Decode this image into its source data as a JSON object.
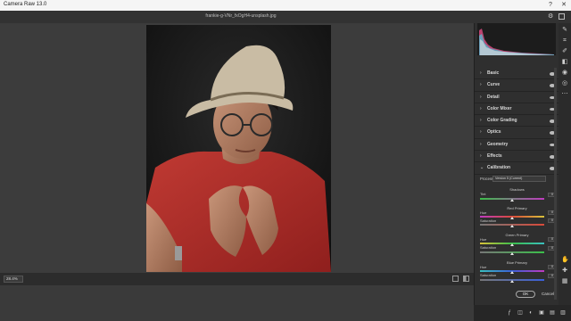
{
  "window": {
    "title": "Camera Raw 13.0",
    "help_label": "?",
    "close_label": "✕"
  },
  "file": {
    "name": "frankie-g-VNr_fxOgH4-unsplash.jpg"
  },
  "canvas": {
    "zoom": "28.4%"
  },
  "panel": {
    "sections": [
      "Basic",
      "Curve",
      "Detail",
      "Color Mixer",
      "Color Grading",
      "Optics",
      "Geometry",
      "Effects",
      "Calibration"
    ],
    "calibration": {
      "process_label": "Process",
      "process_value": "Version 5 (Current)",
      "shadows_title": "Shadows",
      "tint_label": "Tint",
      "tint_value": "0",
      "red_primary_title": "Red Primary",
      "green_primary_title": "Green Primary",
      "blue_primary_title": "Blue Primary",
      "hue_label": "Hue",
      "saturation_label": "Saturation",
      "red_hue": "0",
      "red_sat": "0",
      "green_hue": "0",
      "green_sat": "0",
      "blue_hue": "0",
      "blue_sat": "0"
    },
    "ok_label": "OK",
    "cancel_label": "Cancel"
  },
  "colors": {
    "accent": "#4a8fe0",
    "panel_bg": "#2f2f2f",
    "canvas_bg": "#3c3c3c"
  },
  "icons": [
    "gear-icon",
    "fullscreen-icon",
    "edit-icon",
    "crop-icon",
    "brush-icon",
    "mask-icon",
    "redeye-icon",
    "presets-icon",
    "more-icon",
    "hand-icon",
    "sampler-icon",
    "grid-icon"
  ]
}
